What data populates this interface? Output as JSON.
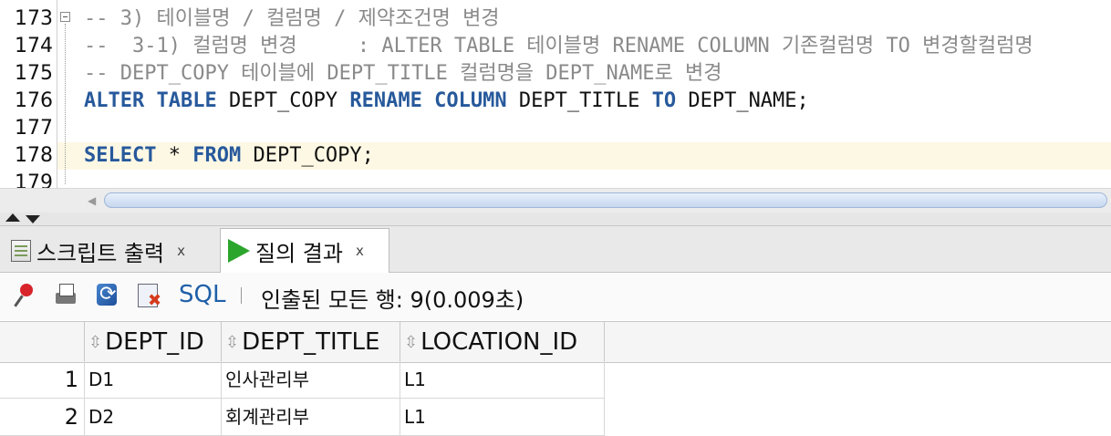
{
  "editor": {
    "lines": [
      {
        "no": "173",
        "parts": [
          {
            "t": "-- 3) 테이블명 / 컬럼명 / 제약조건명 변경",
            "c": "cmt"
          }
        ]
      },
      {
        "no": "174",
        "parts": [
          {
            "t": "--  3-1) 컬럼명 변경     : ALTER TABLE 테이블명 RENAME COLUMN 기존컬럼명 TO 변경할컬럼명",
            "c": "cmt"
          }
        ]
      },
      {
        "no": "175",
        "parts": [
          {
            "t": "-- DEPT_COPY 테이블에 DEPT_TITLE 컬럼명을 DEPT_NAME로 변경",
            "c": "cmt"
          }
        ]
      },
      {
        "no": "176",
        "parts": [
          {
            "t": "ALTER",
            "c": "kw"
          },
          {
            "t": " ",
            "c": ""
          },
          {
            "t": "TABLE",
            "c": "kw"
          },
          {
            "t": " DEPT_COPY ",
            "c": ""
          },
          {
            "t": "RENAME",
            "c": "kw"
          },
          {
            "t": " ",
            "c": ""
          },
          {
            "t": "COLUMN",
            "c": "kw"
          },
          {
            "t": " DEPT_TITLE ",
            "c": ""
          },
          {
            "t": "TO",
            "c": "kw"
          },
          {
            "t": " DEPT_NAME;",
            "c": ""
          }
        ]
      },
      {
        "no": "177",
        "parts": []
      },
      {
        "no": "178",
        "parts": [
          {
            "t": "SELECT",
            "c": "kw"
          },
          {
            "t": " * ",
            "c": ""
          },
          {
            "t": "FROM",
            "c": "kw"
          },
          {
            "t": " DEPT_COPY;",
            "c": ""
          }
        ]
      },
      {
        "no": "179",
        "parts": []
      }
    ]
  },
  "tabs": [
    {
      "label": "스크립트 출력",
      "close": "x",
      "active": false,
      "icon": "script-output-icon"
    },
    {
      "label": "질의 결과",
      "close": "x",
      "active": true,
      "icon": "run-icon"
    }
  ],
  "toolbar": {
    "icons": [
      "pin-icon",
      "print-icon",
      "refresh-icon",
      "clear-icon"
    ],
    "sql_label": "SQL",
    "status": "인출된 모든 행: 9(0.009초)"
  },
  "grid": {
    "columns": [
      "DEPT_ID",
      "DEPT_TITLE",
      "LOCATION_ID"
    ],
    "rows": [
      {
        "num": "1",
        "cells": [
          "D1",
          "인사관리부",
          "L1"
        ]
      },
      {
        "num": "2",
        "cells": [
          "D2",
          "회계관리부",
          "L1"
        ]
      }
    ]
  },
  "colors": {
    "keyword": "#27599b",
    "comment": "#8a8a8a",
    "current_line": "#fdf8e4",
    "sql_link": "#1f5fa8",
    "run_icon": "#2ca52c"
  }
}
